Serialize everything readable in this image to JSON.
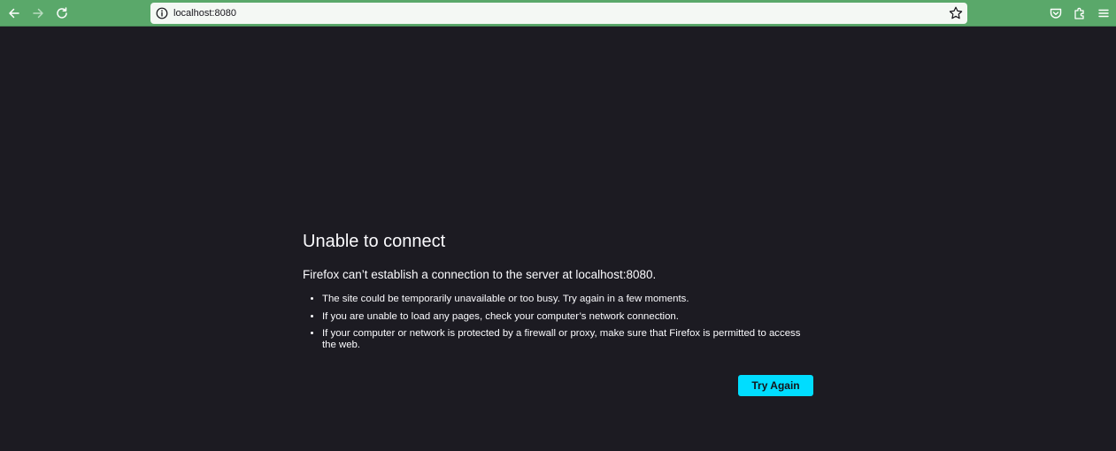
{
  "browser": {
    "url": "localhost:8080",
    "toolbar_color": "#5aa86a",
    "icons": {
      "back": "back-arrow-icon",
      "forward": "forward-arrow-icon",
      "reload": "reload-icon",
      "info": "info-icon",
      "bookmark": "star-icon",
      "pocket": "pocket-icon",
      "extensions": "puzzle-icon",
      "menu": "hamburger-menu-icon"
    }
  },
  "error_page": {
    "title": "Unable to connect",
    "description": "Firefox can’t establish a connection to the server at localhost:8080.",
    "bullets": [
      "The site could be temporarily unavailable or too busy. Try again in a few moments.",
      "If you are unable to load any pages, check your computer’s network connection.",
      "If your computer or network is protected by a firewall or proxy, make sure that Firefox is permitted to access the web."
    ],
    "button_label": "Try Again",
    "button_color": "#00ddff"
  }
}
